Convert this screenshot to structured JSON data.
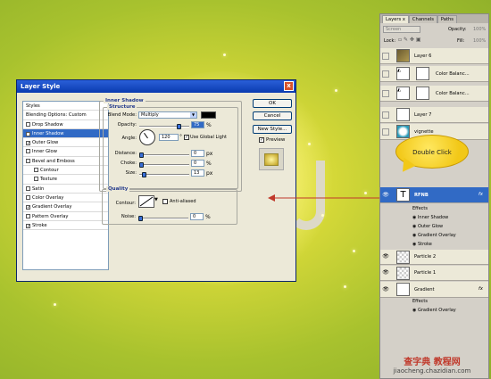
{
  "dialog": {
    "title": "Layer Style",
    "styles_header": "Styles",
    "blending_options": "Blending Options: Custom",
    "style_items": [
      {
        "label": "Drop Shadow",
        "checked": false,
        "selected": false,
        "indent": false
      },
      {
        "label": "Inner Shadow",
        "checked": true,
        "selected": true,
        "indent": false
      },
      {
        "label": "Outer Glow",
        "checked": true,
        "selected": false,
        "indent": false
      },
      {
        "label": "Inner Glow",
        "checked": false,
        "selected": false,
        "indent": false
      },
      {
        "label": "Bevel and Emboss",
        "checked": false,
        "selected": false,
        "indent": false
      },
      {
        "label": "Contour",
        "checked": false,
        "selected": false,
        "indent": true
      },
      {
        "label": "Texture",
        "checked": false,
        "selected": false,
        "indent": true
      },
      {
        "label": "Satin",
        "checked": false,
        "selected": false,
        "indent": false
      },
      {
        "label": "Color Overlay",
        "checked": false,
        "selected": false,
        "indent": false
      },
      {
        "label": "Gradient Overlay",
        "checked": true,
        "selected": false,
        "indent": false
      },
      {
        "label": "Pattern Overlay",
        "checked": false,
        "selected": false,
        "indent": false
      },
      {
        "label": "Stroke",
        "checked": true,
        "selected": false,
        "indent": false
      }
    ],
    "section_title": "Inner Shadow",
    "structure_title": "Structure",
    "blend_mode_label": "Blend Mode:",
    "blend_mode_value": "Multiply",
    "opacity_label": "Opacity:",
    "opacity_value": "75",
    "angle_label": "Angle:",
    "angle_value": "120",
    "use_global_light": "Use Global Light",
    "distance_label": "Distance:",
    "distance_value": "0",
    "choke_label": "Choke:",
    "choke_value": "0",
    "size_label": "Size:",
    "size_value": "13",
    "px": "px",
    "percent": "%",
    "degree": "°",
    "quality_title": "Quality",
    "contour_label": "Contour:",
    "anti_aliased": "Anti-aliased",
    "noise_label": "Noise:",
    "noise_value": "0",
    "ok": "OK",
    "cancel": "Cancel",
    "new_style": "New Style...",
    "preview": "Preview",
    "close": "x"
  },
  "layers_panel": {
    "tabs": [
      "Layers",
      "Channels",
      "Paths"
    ],
    "tab_close": "x",
    "blend_mode": "Screen",
    "opacity_label": "Opacity:",
    "opacity_value": "100%",
    "lock_label": "Lock:",
    "fill_label": "Fill:",
    "fill_value": "100%",
    "layers": [
      {
        "name": "Layer 6",
        "eye": false
      },
      {
        "name": "Color Balanc...",
        "eye": false
      },
      {
        "name": "Color Balanc...",
        "eye": false
      },
      {
        "name": "Layer 7",
        "eye": false
      },
      {
        "name": "vignette",
        "eye": false
      }
    ],
    "text_layer": "RFNB",
    "fx": "fx",
    "effects_label": "Effects",
    "effects": [
      "Inner Shadow",
      "Outer Glow",
      "Gradient Overlay",
      "Stroke"
    ],
    "particle2": "Particle 2",
    "particle1": "Particle 1",
    "gradient_layer": "Gradient",
    "gradient_effects_label": "Effects",
    "gradient_effect": "Gradient Overlay"
  },
  "callout": "Double Click",
  "watermark": {
    "line1": "查字典 教程网",
    "line2": "jiaocheng.chazidian.com"
  },
  "colors": {
    "selection": "#316ac5",
    "callout": "#f2c818",
    "arrow": "#c0392b"
  }
}
